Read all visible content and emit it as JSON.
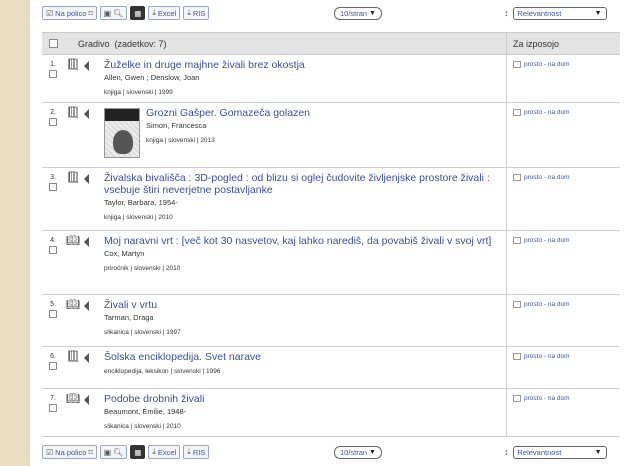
{
  "toolbar": {
    "shelf_label": "Na polico",
    "excel_label": "Excel",
    "ris_label": "RIS",
    "per_page": "10/stran",
    "sort": "Relevantnost"
  },
  "header": {
    "title": "Gradivo",
    "count": "(zadetkov: 7)",
    "availability": "Za izposojo"
  },
  "results": [
    {
      "num": "1.",
      "title": "Žuželke in druge majhne živali brez okostja",
      "authors": "Allen, Gwen ; Denslow, Joan",
      "meta": "knjiga | slovenski | 1999",
      "availability": "prosto - na dom",
      "icon": "book-icon",
      "cover": false
    },
    {
      "num": "2.",
      "title": "Grozni Gašper. Gomazeča golazen",
      "authors": "Simon, Francesca",
      "meta": "knjiga | slovenski | 2013",
      "availability": "prosto - na dom",
      "icon": "book-icon",
      "cover": true
    },
    {
      "num": "3.",
      "title": "Živalska bivališča : 3D-pogled : od blizu si oglej čudovite življenjske prostore živali : vsebuje štiri neverjetne postavljanke",
      "authors": "Taylor, Barbara, 1954-",
      "meta": "knjiga | slovenski | 2010",
      "availability": "prosto - na dom",
      "icon": "book-icon",
      "cover": false
    },
    {
      "num": "4.",
      "title": "Moj naravni vrt : [več kot 30 nasvetov, kaj lahko narediš, da povabiš živali v svoj vrt]",
      "authors": "Cox, Martyn",
      "meta": "priročnik | slovenski | 2010",
      "availability": "prosto - na dom",
      "icon": "open-book-icon",
      "cover": false
    },
    {
      "num": "5.",
      "title": "Živali v vrtu",
      "authors": "Tarman, Draga",
      "meta": "slikanica | slovenski | 1997",
      "availability": "prosto - na dom",
      "icon": "open-book-icon",
      "cover": false
    },
    {
      "num": "6.",
      "title": "Šolska enciklopedija. Svet narave",
      "authors": "",
      "meta": "enciklopedija, leksikon | slovenski | 1996",
      "availability": "prosto - na dom",
      "icon": "book-icon",
      "cover": false
    },
    {
      "num": "7.",
      "title": "Podobe drobnih živali",
      "authors": "Beaumont, Émilie, 1948-",
      "meta": "slikanica | slovenski | 2010",
      "availability": "prosto - na dom",
      "icon": "open-book-icon",
      "cover": false
    }
  ]
}
